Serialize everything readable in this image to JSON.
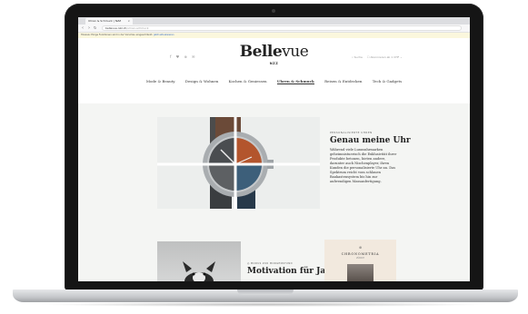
{
  "browser": {
    "tab_title": "Uhren & Schmuck | NZZ",
    "tab_close": "×",
    "back": "‹",
    "forward": "›",
    "reload": "↻",
    "url": "bellevue.nzz.ch",
    "url_suffix": "/uhren-schmuck",
    "info_text": "Hinweis: Einige Funktionen sind in der Vorschau eingeschränkt. ",
    "info_link": "Jetzt aktualisieren"
  },
  "site": {
    "social_icons": "f  ♥  ⊕  ✉",
    "logo_bold": "Belle",
    "logo_light": "vue",
    "logo_sub": "NZZ",
    "search_label": "⌕  Suche",
    "account_label": "☐  Abonnieren ab 1 CHF  ⌄"
  },
  "nav": {
    "items": [
      "Mode & Beauty",
      "Design & Wohnen",
      "Kochen & Geniessen",
      "Uhren & Schmuck",
      "Reisen & Entdecken",
      "Tech & Gadgets"
    ],
    "active_index": 3
  },
  "feature": {
    "kicker": "PERSONALISIERTE UHREN",
    "headline": "Genau meine Uhr",
    "body": "Während viele Luxusuhrmarken\ngeheimnistuerisch die Exklusivität ihrer\nProdukte betonen, hieten andere,\ndarunter auch Nischenplayer, ihren\nKunden die personalisierte Uhr an. Das\nSpektrum reicht vom schlauen\nBaukastensystem bis hin zur\naufwendigen Massanfertigung."
  },
  "second": {
    "kicker": "◎  MODUS ZUR MORGENSTUND",
    "title": "Motivation für Ja-"
  },
  "ad": {
    "mark": "⊕",
    "title": "CHRONOMETRIA",
    "subtitle": "ZÜRICH"
  },
  "colors": {
    "dial_orange": "#b3552d",
    "dial_blue": "#3d5f7a",
    "case_steel": "#9ea3a7"
  }
}
